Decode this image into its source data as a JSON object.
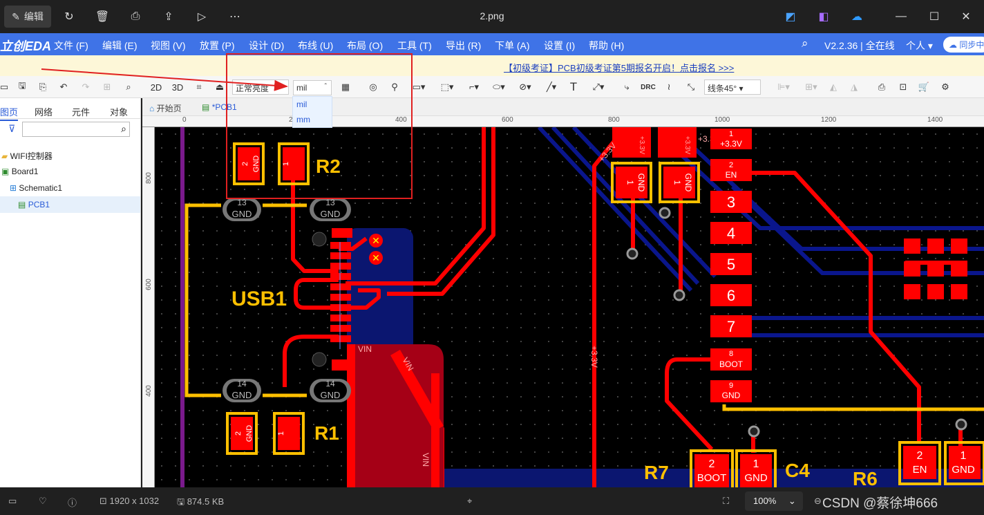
{
  "viewer": {
    "edit_label": "编辑",
    "file_name": "2.png",
    "status": {
      "dimensions": "1920 x 1032",
      "size": "874.5 KB",
      "zoom": "100%"
    },
    "watermark": "CSDN @蔡徐坤666"
  },
  "eda": {
    "logo": "立创EDA",
    "menu": [
      "文件 (F)",
      "编辑 (E)",
      "视图 (V)",
      "放置 (P)",
      "设计 (D)",
      "布线 (U)",
      "布局 (O)",
      "工具 (T)",
      "导出 (R)",
      "下单 (A)",
      "设置 (I)",
      "帮助 (H)"
    ],
    "version": "V2.2.36 | 全在线",
    "personal": "个人",
    "sync": "同步中",
    "notice": "【初级考证】PCB初级考证第5期报名开启！点击报名 >>>",
    "toolbar": {
      "view2d": "2D",
      "view3d": "3D",
      "display_mode": "正常亮度",
      "unit": "mil",
      "unit_options": [
        "mil",
        "mm"
      ],
      "drc": "DRC",
      "route_mode": "线条45°"
    },
    "left_tabs": [
      "图页",
      "网络",
      "元件",
      "对象"
    ],
    "tree": [
      "WIFI控制器",
      "Board1",
      "Schematic1",
      "PCB1"
    ],
    "doc_tabs": [
      "开始页",
      "*PCB1"
    ],
    "ruler_top": [
      "0",
      "200",
      "400",
      "600",
      "800",
      "1000",
      "1200",
      "1400"
    ],
    "ruler_left": [
      "800",
      "600",
      "400"
    ]
  },
  "pcb": {
    "components": [
      "R2",
      "USB1",
      "R1",
      "R7",
      "C4",
      "R6"
    ],
    "pads": {
      "gnd": "GND",
      "p1": "1",
      "p2": "2",
      "p13": "13",
      "p14": "14",
      "vin": "VIN",
      "v33": "+3.3V",
      "en": "EN",
      "boot": "BOOT",
      "h3": "3",
      "h4": "4",
      "h5": "5",
      "h6": "6",
      "h7": "7",
      "h8": "8",
      "h9": "9"
    }
  },
  "colors": {
    "pcb_bg": "#000000",
    "top_copper": "#ff0000",
    "bottom_copper": "#000c8c",
    "silkscreen": "#ffcc00",
    "menu_blue": "#3f73e7",
    "annotation_red": "#e02020"
  }
}
